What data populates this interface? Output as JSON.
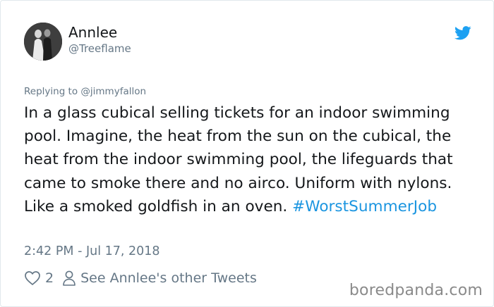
{
  "tweet": {
    "display_name": "Annlee",
    "handle": "@Treeflame",
    "replying_to": "Replying to @jimmyfallon",
    "text": "In a glass cubical selling tickets for an indoor swimming pool. Imagine, the heat from the sun on the cubical, the heat from the indoor swimming pool, the lifeguards that came to smoke there and no airco. Uniform with nylons. Like a smoked goldfish in an oven. ",
    "hashtag": "#WorstSummerJob",
    "timestamp": "2:42 PM - Jul 17, 2018",
    "likes": "2",
    "other_tweets_link": "See Annlee's other Tweets"
  },
  "icons": {
    "brand": "twitter-bird-icon",
    "like": "heart-icon",
    "profile": "person-icon"
  },
  "colors": {
    "accent": "#1da1f2",
    "hashtag": "#1b95e0",
    "muted": "#657786",
    "text": "#14171a"
  },
  "watermark": "boredpanda.com"
}
